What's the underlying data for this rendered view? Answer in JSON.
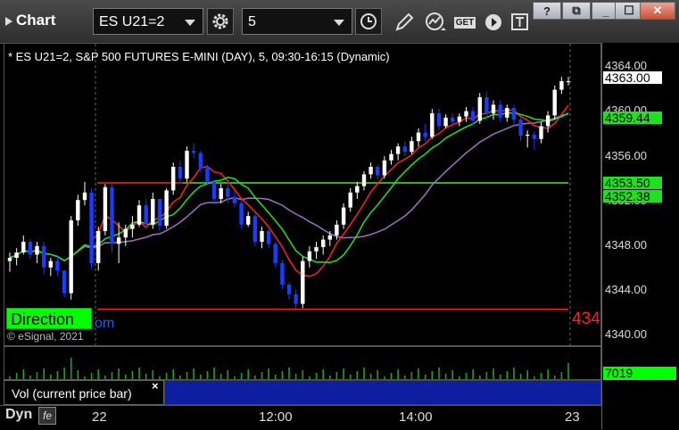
{
  "app": {
    "title": "Chart"
  },
  "toolbar": {
    "symbol": "ES U21=2",
    "interval": "5",
    "get_label": "GET"
  },
  "window": {
    "help": "?",
    "restore": "⧉",
    "minimize": "_",
    "maximize": "☐",
    "close": "✕"
  },
  "chart": {
    "info": "* ES U21=2, S&P 500 FUTURES E-MINI (DAY), 5, 09:30-16:15 (Dynamic)",
    "direction_label": "Direction",
    "direction_suffix": "om",
    "copyright": "© eSignal, 2021",
    "red_level_label": "434",
    "y_labels": [
      "4364.00",
      "4360.00",
      "4356.00",
      "4352.00",
      "4348.00",
      "4344.00",
      "4340.00"
    ],
    "price_tags": {
      "last": "4363.00",
      "green1": "4359.44",
      "green2": "4353.50",
      "green3": "4352.38"
    },
    "x_labels": [
      "22",
      "12:00",
      "14:00",
      "23"
    ],
    "colors": {
      "up": "#ffffff",
      "down": "#1a3cff",
      "red_line": "#ff2020",
      "green_line": "#1fe21f",
      "purple_line": "#a070c0"
    }
  },
  "volume": {
    "label": "Vol (current price bar)",
    "close": "×",
    "value": "7019"
  },
  "footer": {
    "mode": "Dyn",
    "icon_label": "fe"
  },
  "chart_data": {
    "type": "candlestick",
    "ylim": [
      4339,
      4366
    ],
    "candles": [
      [
        4346.2,
        4347.0,
        4345.2,
        4346.5
      ],
      [
        4346.5,
        4347.4,
        4345.8,
        4347.0
      ],
      [
        4347.0,
        4348.6,
        4346.8,
        4348.0
      ],
      [
        4348.0,
        4348.2,
        4346.4,
        4346.8
      ],
      [
        4346.8,
        4348.0,
        4346.0,
        4347.6
      ],
      [
        4347.6,
        4348.0,
        4345.0,
        4345.6
      ],
      [
        4345.6,
        4346.5,
        4344.8,
        4346.2
      ],
      [
        4346.2,
        4346.6,
        4344.8,
        4345.3
      ],
      [
        4345.3,
        4345.4,
        4342.8,
        4343.2
      ],
      [
        4343.2,
        4350.4,
        4342.6,
        4350.0
      ],
      [
        4350.0,
        4352.4,
        4349.5,
        4351.9
      ],
      [
        4351.9,
        4353.6,
        4351.4,
        4352.6
      ],
      [
        4352.6,
        4353.0,
        4345.5,
        4346.0
      ],
      [
        4346.0,
        4349.4,
        4345.3,
        4349.0
      ],
      [
        4349.0,
        4353.4,
        4348.6,
        4353.1
      ],
      [
        4353.1,
        4353.6,
        4347.0,
        4347.8
      ],
      [
        4347.8,
        4349.8,
        4346.0,
        4348.4
      ],
      [
        4348.4,
        4349.6,
        4347.6,
        4349.2
      ],
      [
        4349.2,
        4350.4,
        4348.4,
        4349.6
      ],
      [
        4349.6,
        4351.9,
        4349.4,
        4351.4
      ],
      [
        4351.4,
        4352.0,
        4349.3,
        4349.6
      ],
      [
        4349.6,
        4352.6,
        4349.2,
        4352.0
      ],
      [
        4352.0,
        4351.8,
        4349.0,
        4349.5
      ],
      [
        4349.5,
        4353.0,
        4349.2,
        4352.8
      ],
      [
        4352.8,
        4355.4,
        4352.4,
        4355.0
      ],
      [
        4355.0,
        4355.6,
        4353.4,
        4353.9
      ],
      [
        4353.9,
        4356.9,
        4353.6,
        4356.5
      ],
      [
        4356.5,
        4357.2,
        4355.8,
        4356.3
      ],
      [
        4356.3,
        4356.5,
        4354.5,
        4354.9
      ],
      [
        4354.9,
        4355.2,
        4353.3,
        4353.6
      ],
      [
        4353.6,
        4353.8,
        4351.5,
        4352.0
      ],
      [
        4352.0,
        4353.4,
        4351.6,
        4353.0
      ],
      [
        4353.0,
        4353.6,
        4351.6,
        4352.2
      ],
      [
        4352.2,
        4352.8,
        4351.2,
        4351.6
      ],
      [
        4351.6,
        4351.8,
        4349.2,
        4349.6
      ],
      [
        4349.6,
        4350.8,
        4349.4,
        4350.4
      ],
      [
        4350.4,
        4350.6,
        4347.6,
        4348.0
      ],
      [
        4348.0,
        4349.4,
        4347.4,
        4349.0
      ],
      [
        4349.0,
        4349.2,
        4347.4,
        4347.8
      ],
      [
        4347.8,
        4348.0,
        4345.6,
        4346.0
      ],
      [
        4346.0,
        4346.3,
        4343.6,
        4344.0
      ],
      [
        4344.0,
        4344.2,
        4342.6,
        4343.1
      ],
      [
        4343.1,
        4343.6,
        4341.6,
        4342.2
      ],
      [
        4342.2,
        4346.6,
        4341.8,
        4346.2
      ],
      [
        4346.2,
        4347.6,
        4345.6,
        4347.1
      ],
      [
        4347.1,
        4348.0,
        4346.4,
        4347.5
      ],
      [
        4347.5,
        4348.6,
        4346.8,
        4348.2
      ],
      [
        4348.2,
        4349.0,
        4347.6,
        4348.6
      ],
      [
        4348.6,
        4350.0,
        4348.2,
        4349.6
      ],
      [
        4349.6,
        4351.6,
        4349.2,
        4351.2
      ],
      [
        4351.2,
        4353.0,
        4350.8,
        4352.6
      ],
      [
        4352.6,
        4353.6,
        4352.0,
        4353.2
      ],
      [
        4353.2,
        4354.6,
        4352.8,
        4354.3
      ],
      [
        4354.3,
        4355.4,
        4353.9,
        4355.0
      ],
      [
        4355.0,
        4355.2,
        4353.8,
        4354.2
      ],
      [
        4354.2,
        4356.0,
        4353.9,
        4355.6
      ],
      [
        4355.6,
        4356.6,
        4355.2,
        4356.2
      ],
      [
        4356.2,
        4357.2,
        4355.6,
        4356.9
      ],
      [
        4356.9,
        4357.4,
        4356.0,
        4356.4
      ],
      [
        4356.4,
        4357.8,
        4356.2,
        4357.4
      ],
      [
        4357.4,
        4358.6,
        4356.9,
        4358.2
      ],
      [
        4358.2,
        4359.0,
        4357.4,
        4357.8
      ],
      [
        4357.8,
        4360.4,
        4357.6,
        4360.0
      ],
      [
        4360.0,
        4360.4,
        4358.4,
        4358.8
      ],
      [
        4358.8,
        4359.9,
        4358.6,
        4359.6
      ],
      [
        4359.6,
        4360.0,
        4358.6,
        4359.2
      ],
      [
        4359.2,
        4360.0,
        4358.8,
        4359.7
      ],
      [
        4359.7,
        4360.6,
        4359.2,
        4360.2
      ],
      [
        4360.2,
        4360.6,
        4358.8,
        4359.3
      ],
      [
        4359.3,
        4361.9,
        4359.0,
        4361.5
      ],
      [
        4361.5,
        4362.0,
        4359.6,
        4360.0
      ],
      [
        4360.0,
        4361.2,
        4359.4,
        4360.8
      ],
      [
        4360.8,
        4361.2,
        4359.2,
        4359.6
      ],
      [
        4359.6,
        4360.8,
        4359.2,
        4360.5
      ],
      [
        4360.5,
        4360.8,
        4359.0,
        4359.4
      ],
      [
        4359.4,
        4359.6,
        4357.4,
        4357.9
      ],
      [
        4357.9,
        4358.4,
        4356.8,
        4358.0
      ],
      [
        4358.0,
        4358.3,
        4356.6,
        4357.6
      ],
      [
        4357.6,
        4359.2,
        4357.2,
        4358.8
      ],
      [
        4358.8,
        4360.2,
        4358.2,
        4359.8
      ],
      [
        4359.8,
        4362.6,
        4359.4,
        4362.2
      ],
      [
        4362.2,
        4363.4,
        4361.8,
        4363.0
      ],
      [
        4363.0,
        4363.4,
        4362.6,
        4363.0
      ]
    ],
    "lines": {
      "red_horizontal_upper": 4353.5,
      "red_horizontal_lower": 4341.7,
      "green_horizontal": 4353.5
    },
    "volume_last": 7019
  }
}
